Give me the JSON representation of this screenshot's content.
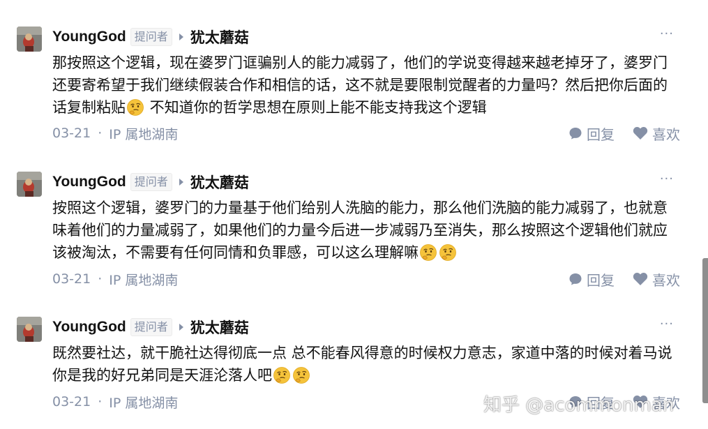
{
  "comments": [
    {
      "author": "YoungGod",
      "badge": "提问者",
      "reply_to": "犹太蘑菇",
      "text_parts": [
        "那按照这个逻辑，现在婆罗门诓骗别人的能力减弱了，他们的学说变得越来越老掉牙了，婆罗门还要寄希望于我们继续假装合作和相信的话，这不就是要限制觉醒者的力量吗？然后把你后面的话复制粘贴",
        " 不知道你的哲学思想在原则上能不能支持我这个逻辑"
      ],
      "emoji": "thinking-face-emoji",
      "date": "03-21",
      "separator": "·",
      "location": "IP 属地湖南",
      "reply_label": "回复",
      "like_label": "喜欢",
      "more": "···"
    },
    {
      "author": "YoungGod",
      "badge": "提问者",
      "reply_to": "犹太蘑菇",
      "text_parts": [
        "按照这个逻辑，婆罗门的力量基于他们给别人洗脑的能力，那么他们洗脑的能力减弱了，也就意味着他们的力量减弱了，如果他们的力量今后进一步减弱乃至消失，那么按照这个逻辑他们就应该被淘汰，不需要有任何同情和负罪感，可以这么理解嘛"
      ],
      "emoji": "thinking-face-emoji",
      "date": "03-21",
      "separator": "·",
      "location": "IP 属地湖南",
      "reply_label": "回复",
      "like_label": "喜欢",
      "more": "···"
    },
    {
      "author": "YoungGod",
      "badge": "提问者",
      "reply_to": "犹太蘑菇",
      "text_parts": [
        "既然要社达，就干脆社达得彻底一点 总不能春风得意的时候权力意志，家道中落的时候对着马说你是我的好兄弟同是天涯沦落人吧"
      ],
      "emoji": "thinking-face-emoji",
      "date": "03-21",
      "separator": "·",
      "location": "IP 属地湖南",
      "reply_label": "回复",
      "like_label": "喜欢",
      "more": "···"
    }
  ],
  "watermark": "知乎 @acommonman",
  "colors": {
    "text": "#121212",
    "meta": "#8590a6",
    "badge_bg": "#f6f6f6",
    "scrollbar": "#8e8e8e"
  }
}
